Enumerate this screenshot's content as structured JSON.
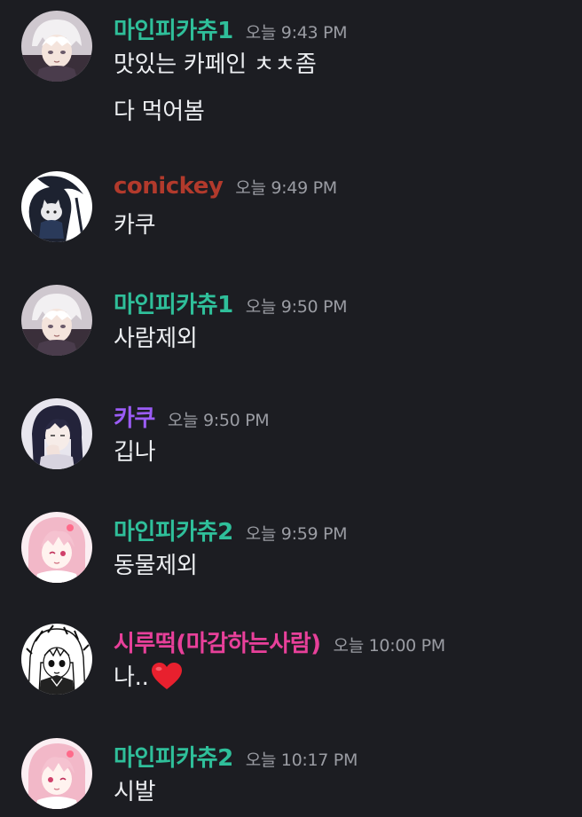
{
  "colors": {
    "background": "#1c1d22",
    "teal_user": "#2fbf9a",
    "conickey_user": "#b23a2c",
    "kaku_user": "#9b5cf6",
    "pink_user": "#e8409a",
    "timestamp": "#9a9ca3",
    "message_text": "#eceef1"
  },
  "messages": [
    {
      "username": "마인피카츄1",
      "timestamp": "오늘 9:43 PM",
      "lines": [
        "맛있는 카페인 ㅊㅊ좀",
        "다 먹어봄"
      ],
      "avatar_icon": "white-haired-boy-avatar"
    },
    {
      "username": "conickey",
      "timestamp": "오늘 9:49 PM",
      "lines": [
        "카쿠"
      ],
      "avatar_icon": "grim-reaper-cat-avatar"
    },
    {
      "username": "마인피카츄1",
      "timestamp": "오늘 9:50 PM",
      "lines": [
        "사람제외"
      ],
      "avatar_icon": "white-haired-boy-avatar"
    },
    {
      "username": "카쿠",
      "timestamp": "오늘 9:50 PM",
      "lines": [
        "깁나"
      ],
      "avatar_icon": "dark-haired-girl-avatar"
    },
    {
      "username": "마인피카츄2",
      "timestamp": "오늘 9:59 PM",
      "lines": [
        "동물제외"
      ],
      "avatar_icon": "pink-haired-girl-avatar"
    },
    {
      "username": "시루떡(마감하는사람)",
      "timestamp": "오늘 10:00 PM",
      "lines": [
        "나.."
      ],
      "avatar_icon": "manga-sketch-avatar",
      "emoji": "red-heart-emoji"
    },
    {
      "username": "마인피카츄2",
      "timestamp": "오늘 10:17 PM",
      "lines": [
        "시발"
      ],
      "avatar_icon": "pink-haired-girl-avatar"
    }
  ]
}
